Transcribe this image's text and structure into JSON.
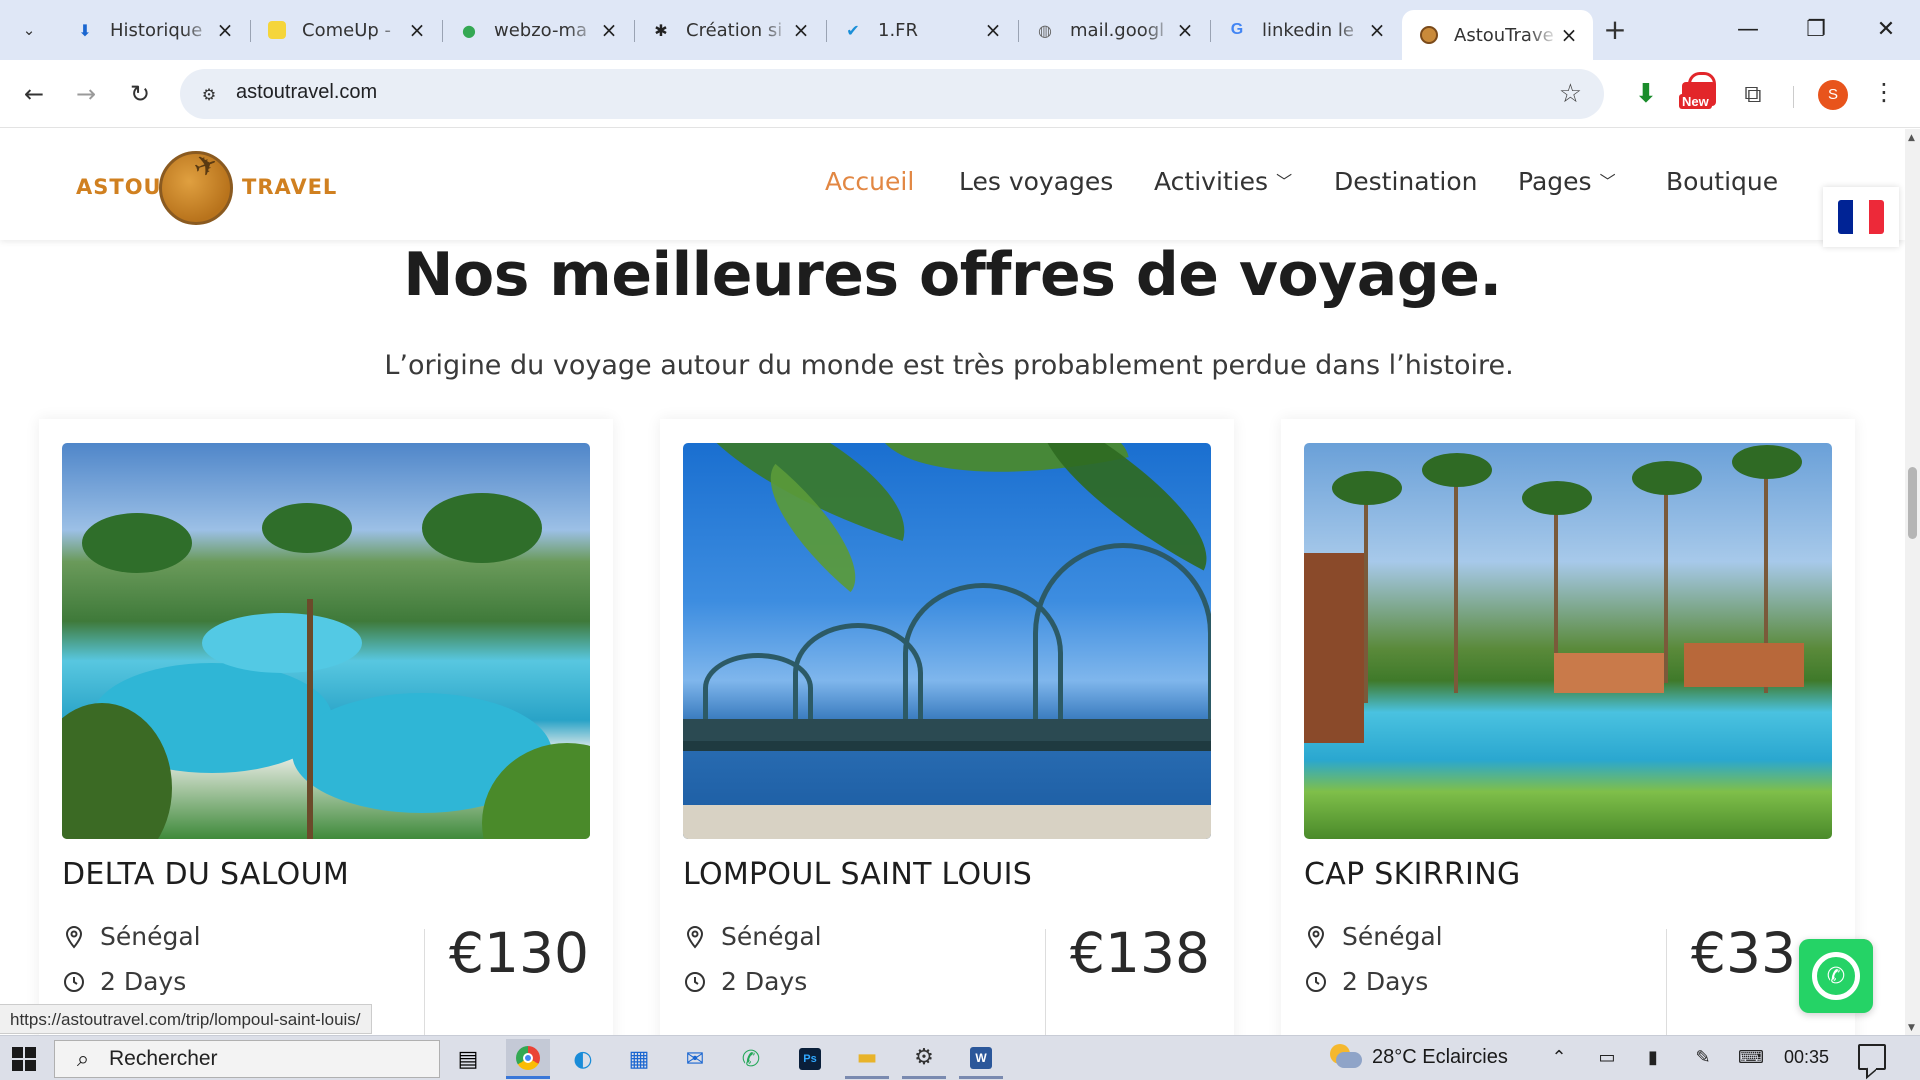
{
  "browser": {
    "tabs": [
      {
        "title": "Historique",
        "icon": "download-icon"
      },
      {
        "title": "ComeUp -",
        "icon": "comeup-icon"
      },
      {
        "title": "webzo-ma",
        "icon": "maps-pin-icon"
      },
      {
        "title": "Création si",
        "icon": "openai-icon"
      },
      {
        "title": "1.FR",
        "icon": "check-logo-icon"
      },
      {
        "title": "mail.googl",
        "icon": "globe-icon"
      },
      {
        "title": "linkedin le",
        "icon": "google-icon"
      },
      {
        "title": "AstouTrave",
        "icon": "astou-favicon-icon",
        "active": true
      }
    ],
    "url": "astoutravel.com",
    "profile_initial": "S",
    "ext_new_badge": "New"
  },
  "site": {
    "logo_left": "ASTOU",
    "logo_right": "TRAVEL",
    "nav": [
      {
        "label": "Accueil",
        "active": true
      },
      {
        "label": "Les voyages"
      },
      {
        "label": "Activities",
        "dropdown": true
      },
      {
        "label": "Destination"
      },
      {
        "label": "Pages",
        "dropdown": true
      },
      {
        "label": "Boutique"
      }
    ],
    "section_title": "Nos meilleures offres de voyage.",
    "section_subtitle": "L’origine du voyage autour du monde est très probablement perdue dans l’histoire.",
    "trips": [
      {
        "name": "DELTA DU SALOUM",
        "country": "Sénégal",
        "duration": "2 Days",
        "price": "€130"
      },
      {
        "name": "LOMPOUL SAINT LOUIS",
        "country": "Sénégal",
        "duration": "2 Days",
        "price": "€138"
      },
      {
        "name": "CAP SKIRRING",
        "country": "Sénégal",
        "duration": "2 Days",
        "price": "€33"
      }
    ],
    "flag_colors": [
      "#002395",
      "#ffffff",
      "#ed2939"
    ],
    "accent_color": "#e28743"
  },
  "status_url": "https://astoutravel.com/trip/lompoul-saint-louis/",
  "taskbar": {
    "search_placeholder": "Rechercher",
    "weather": "28°C  Eclaircies",
    "time": "00:35"
  }
}
